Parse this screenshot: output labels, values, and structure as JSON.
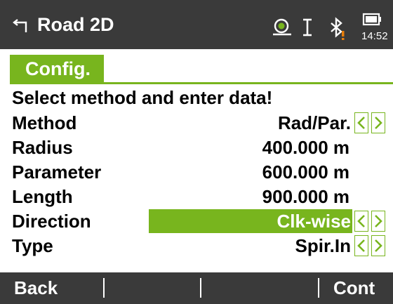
{
  "titlebar": {
    "title": "Road 2D",
    "time": "14:52",
    "icons": [
      "back-arrow-icon",
      "prism-target-icon",
      "cursor-i-icon",
      "bluetooth-icon",
      "battery-icon"
    ],
    "warning_color": "#e87e0a"
  },
  "tab": {
    "label": "Config."
  },
  "prompt": "Select method and enter data!",
  "fields": [
    {
      "label": "Method",
      "value": "Rad/Par.",
      "has_arrows": true,
      "selected": false
    },
    {
      "label": "Radius",
      "value": "400.000 m",
      "has_arrows": false,
      "selected": false
    },
    {
      "label": "Parameter",
      "value": "600.000 m",
      "has_arrows": false,
      "selected": false
    },
    {
      "label": "Length",
      "value": "900.000 m",
      "has_arrows": false,
      "selected": false
    },
    {
      "label": "Direction",
      "value": "Clk-wise",
      "has_arrows": true,
      "selected": true
    },
    {
      "label": "Type",
      "value": "Spir.In",
      "has_arrows": true,
      "selected": false
    }
  ],
  "softkeys": {
    "f1": "Back",
    "f2": "",
    "f3": "",
    "f4": "Cont"
  },
  "colors": {
    "accent": "#78b51e",
    "bar": "#3a3a3a",
    "text": "#000000"
  }
}
